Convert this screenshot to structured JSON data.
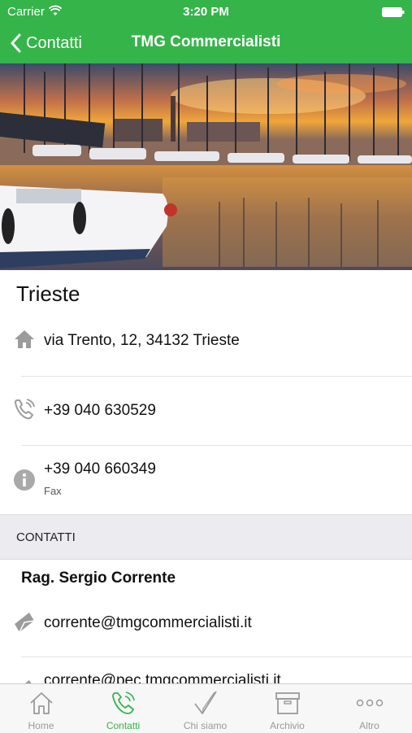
{
  "status_bar": {
    "carrier": "Carrier",
    "time": "3:20 PM"
  },
  "nav": {
    "back_label": "Contatti",
    "title": "TMG Commercialisti"
  },
  "office": {
    "city": "Trieste",
    "address": "via Trento, 12, 34132 Trieste",
    "phone": "+39 040 630529",
    "fax_number": "+39 040 660349",
    "fax_label": "Fax"
  },
  "contacts_section": {
    "header": "CONTATTI",
    "person_name": "Rag. Sergio Corrente",
    "email": "corrente@tmgcommercialisti.it",
    "pec_email": "corrente@pec.tmgcommercialisti.it"
  },
  "tabs": [
    {
      "label": "Home",
      "icon": "home-icon"
    },
    {
      "label": "Contatti",
      "icon": "phone-icon",
      "active": true
    },
    {
      "label": "Chi siamo",
      "icon": "checkmark-icon"
    },
    {
      "label": "Archivio",
      "icon": "archive-box-icon"
    },
    {
      "label": "Altro",
      "icon": "more-dots-icon"
    }
  ],
  "colors": {
    "accent": "#35b44a",
    "section_bg": "#ebebf0",
    "tab_inactive": "#9a9a9a"
  }
}
